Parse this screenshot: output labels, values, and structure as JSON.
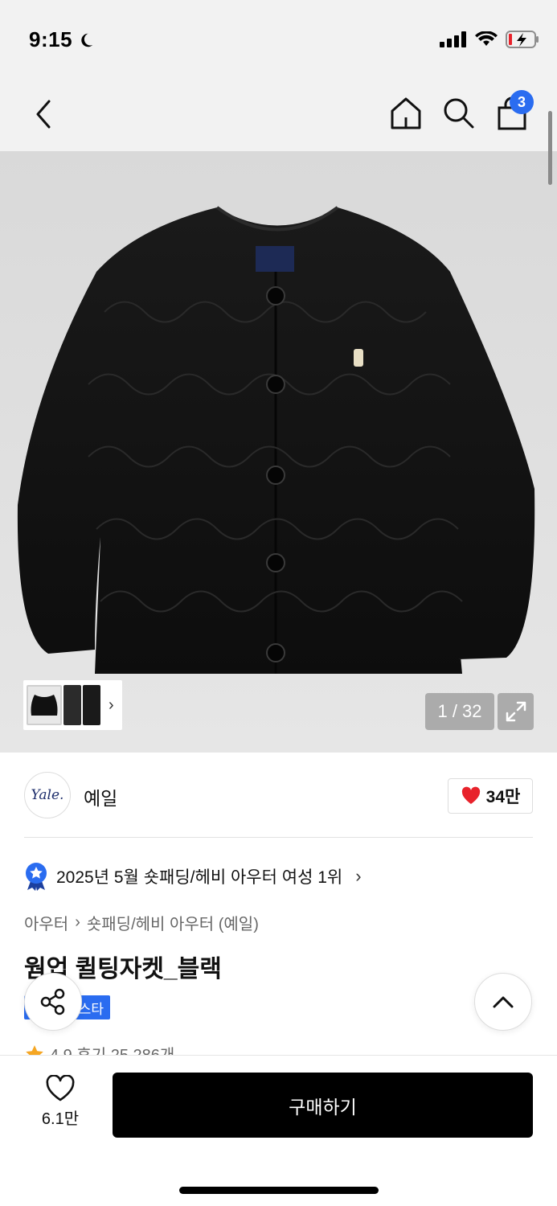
{
  "status_bar": {
    "time": "9:15",
    "icons": [
      "moon-icon",
      "cellular-signal-icon",
      "wifi-icon",
      "battery-charging-icon"
    ]
  },
  "nav": {
    "icons": [
      "back-chevron-icon",
      "home-icon",
      "search-icon",
      "shopping-bag-icon"
    ],
    "cart_count": "3"
  },
  "gallery": {
    "page_counter": "1 / 32",
    "thumb_more_glyph": "›"
  },
  "brand": {
    "logo_text": "Yale.",
    "name": "예일",
    "likes": "34만"
  },
  "ranking": {
    "text": "2025년 5월 숏패딩/헤비 아우터 여성 1위",
    "arrow": "›"
  },
  "breadcrumb": {
    "level1": "아우터",
    "separator": "›",
    "level2": "숏패딩/헤비 아우터 (예일)"
  },
  "product": {
    "title": "웜업 퀼팅자켓_블랙",
    "badge": "스타",
    "rating_line": "4.9 후기 25,286개"
  },
  "bottom_bar": {
    "wish_count": "6.1만",
    "buy_label": "구매하기"
  },
  "colors": {
    "accent_blue": "#2a6cf0",
    "heart_red": "#e8222b",
    "buy_button": "#000000",
    "hero_bg": "#dddddd"
  }
}
